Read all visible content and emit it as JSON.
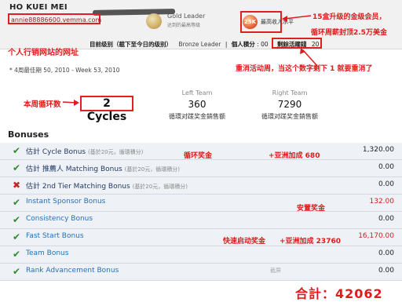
{
  "header": {
    "member_name": "HO KUEI MEI",
    "website_url": "annie88886600.vemma.com",
    "rank_title": "Gold Leader",
    "rank_subtitle": "达到的最高等级",
    "income_badge": "25K",
    "max_income_label": "最高收入水平",
    "current_level_label": "目前级别（截下至今日的级别）",
    "current_level_value": "Bronze Leader",
    "personal_points_label": "個人積分",
    "personal_points_value": "00",
    "remaining_refs_label": "剩餘活躍錢",
    "remaining_refs_value": "20"
  },
  "annotations": {
    "website_note": "个人行销网站的网址",
    "gold_member_note_1": "15盒升级的金级会员，",
    "gold_member_note_2": "循环周薪封顶2.5万美金",
    "restart_week_note": "重消活动周，当这个数字剩下 1 就要重消了",
    "cycles_note": "本周循环数",
    "cycle_bonus_note": "循环奖金",
    "asia_cycle_note": "+亚洲加成  680",
    "sponsor_bonus_note": "安置奖金",
    "fast_start_note": "快速启动奖金",
    "asia_fast_note": "+亚洲加成 23760",
    "total_note": "合計：42062"
  },
  "week_range": "* 4周最佳期 50, 2010 - Week 53, 2010",
  "cycles": {
    "value": "2 Cycles"
  },
  "teams": {
    "left": {
      "label": "Left Team",
      "value": "360",
      "sub": "循環对蹉奖金銷售额"
    },
    "right": {
      "label": "Right Team",
      "value": "7290",
      "sub": "循環对蹉奖金銷售额"
    }
  },
  "bonuses_title": "Bonuses",
  "bonuses": [
    {
      "status": "check",
      "label": "估計 Cycle Bonus",
      "note": "(基於20元，循環積分)",
      "amount": "1,320.00",
      "red": false
    },
    {
      "status": "check",
      "label": "估計 推薦人 Matching Bonus",
      "note": "(基於20元，循環積分)",
      "amount": "0.00",
      "red": false
    },
    {
      "status": "cross",
      "label": "估計 2nd Tier Matching Bonus",
      "note": "(基於20元，循環積分)",
      "amount": "0.00",
      "red": false
    },
    {
      "status": "check",
      "label": "Instant Sponsor Bonus",
      "note": "",
      "amount": "132.00",
      "red": true
    },
    {
      "status": "check",
      "label": "Consistency Bonus",
      "note": "",
      "amount": "0.00",
      "red": false
    },
    {
      "status": "check",
      "label": "Fast Start Bonus",
      "note": "",
      "amount": "16,170.00",
      "red": true
    },
    {
      "status": "check",
      "label": "Team Bonus",
      "note": "",
      "amount": "0.00",
      "red": false
    },
    {
      "status": "check",
      "label": "Rank Advancement Bonus",
      "note": "",
      "amount": "0.00",
      "red": false
    }
  ],
  "footer_faint": "截屏",
  "colors": {
    "annotation_red": "#e01b1b",
    "check_green": "#2e8b2e",
    "row_bg": "#eef2f7"
  }
}
